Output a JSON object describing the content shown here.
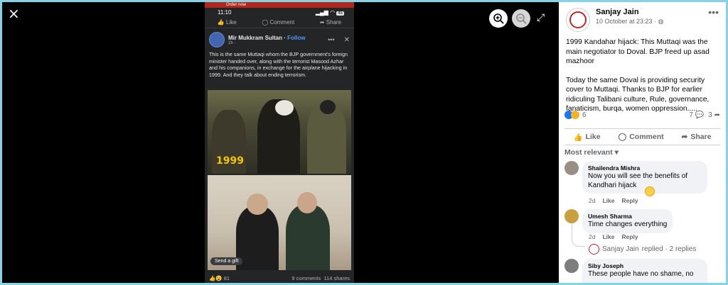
{
  "viewer": {
    "close_label": "×",
    "expand_label": "⤢"
  },
  "phone": {
    "top_banner": "Order now",
    "status_time": "11:10",
    "battery": "45",
    "actions": {
      "like": "Like",
      "comment": "Comment",
      "share": "Share"
    },
    "post": {
      "author": "Mir Mukkram Sultan",
      "follow": "Follow",
      "time": "1h ·",
      "text": "This is the same Muttaqi whom the BJP government's foreign minister handed over, along with the terrorist Masood Azhar and his companions, in exchange for the airplane hijacking in 1999. And they talk about ending terrorism."
    },
    "image_year": "1999",
    "send_gift": "Send a gift",
    "reactions_count": "81",
    "comments": "9 comments",
    "shares": "114 shares"
  },
  "panel": {
    "author": "Sanjay Jain",
    "date": "10 October at 23:23 ·",
    "body": [
      "1999 Kandahar hijack: This Muttaqi was the main negotiator to Doval. BJP freed up asad mazhoor",
      "Today the same Doval is providing security cover to Muttaqi. Thanks to BJP for earlier ridiculing Talibani culture, Rule, governance, fanaticism, burqa, women oppression....."
    ],
    "reactions_count": "6",
    "comments_count": "7",
    "shares_count": "3",
    "actions": {
      "like": "Like",
      "comment": "Comment",
      "share": "Share"
    },
    "sort_label": "Most relevant",
    "comments": [
      {
        "name": "Shailendra Mishra",
        "text": "Now you will see the benefits of Kandhari hijack",
        "age": "2d",
        "like": "Like",
        "reply": "Reply"
      },
      {
        "name": "Umesh Sharma",
        "text": "Time changes everything",
        "age": "2d",
        "like": "Like",
        "reply": "Reply"
      },
      {
        "name": "Siby Joseph",
        "text": "These people have no shame, no"
      }
    ],
    "replied": {
      "name": "Sanjay Jain",
      "text": "replied · 2 replies"
    }
  },
  "colors": {
    "fb_blue": "#1877f2",
    "dark_bg": "#242526",
    "year_yellow": "#f5c400"
  }
}
